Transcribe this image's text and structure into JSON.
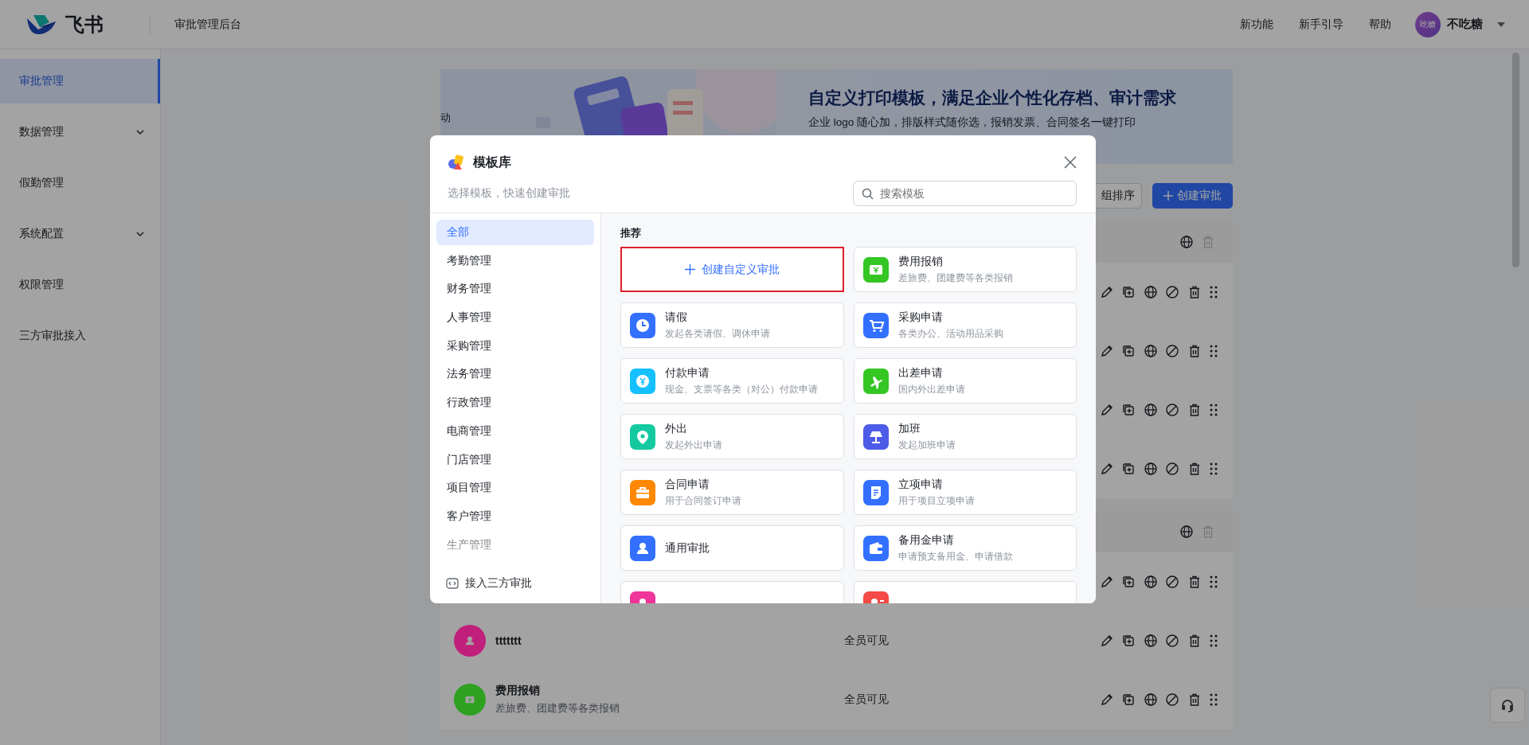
{
  "topbar": {
    "brand": "飞书",
    "title": "审批管理后台",
    "links": [
      "新功能",
      "新手引导",
      "帮助"
    ],
    "user": {
      "avatar_text": "吃糖",
      "name": "不吃糖"
    }
  },
  "sidebar": {
    "items": [
      {
        "label": "审批管理",
        "selected": true,
        "has_submenu": false
      },
      {
        "label": "数据管理",
        "selected": false,
        "has_submenu": true
      },
      {
        "label": "假勤管理",
        "selected": false,
        "has_submenu": false
      },
      {
        "label": "系统配置",
        "selected": false,
        "has_submenu": true
      },
      {
        "label": "权限管理",
        "selected": false,
        "has_submenu": false
      },
      {
        "label": "三方审批接入",
        "selected": false,
        "has_submenu": false
      }
    ]
  },
  "banner": {
    "left_text": "动",
    "title": "自定义打印模板，满足企业个性化存档、审计需求",
    "subtitle": "企业 logo 随心加，排版样式随你选，报销发票、合同签名一键打印"
  },
  "toolbar": {
    "buttons": [
      {
        "label": "组排序",
        "kind": "secondary"
      },
      {
        "label": "创建审批",
        "kind": "primary"
      }
    ]
  },
  "groups": [
    {
      "delete_disabled": true,
      "rows": [
        {
          "kind": "covered"
        },
        {
          "kind": "covered"
        },
        {
          "kind": "covered"
        },
        {
          "kind": "covered"
        }
      ]
    },
    {
      "delete_disabled": true,
      "rows": [
        {
          "kind": "covered"
        },
        {
          "kind": "item",
          "name": "ttttttt",
          "visibility": "全员可见",
          "color": "#c0207c"
        },
        {
          "kind": "item",
          "name": "费用报销",
          "description": "差旅费、团建费等各类报销",
          "visibility": "全员可见",
          "color": "#2ea121"
        }
      ]
    }
  ],
  "modal": {
    "title": "模板库",
    "subtitle": "选择模板，快速创建审批",
    "search": {
      "placeholder": "搜索模板"
    },
    "categories": [
      {
        "label": "全部",
        "selected": true
      },
      {
        "label": "考勤管理",
        "selected": false
      },
      {
        "label": "财务管理",
        "selected": false
      },
      {
        "label": "人事管理",
        "selected": false
      },
      {
        "label": "采购管理",
        "selected": false
      },
      {
        "label": "法务管理",
        "selected": false
      },
      {
        "label": "行政管理",
        "selected": false
      },
      {
        "label": "电商管理",
        "selected": false
      },
      {
        "label": "门店管理",
        "selected": false
      },
      {
        "label": "项目管理",
        "selected": false
      },
      {
        "label": "客户管理",
        "selected": false
      },
      {
        "label": "生产管理",
        "selected": false
      }
    ],
    "footer_link": "接入三方审批",
    "section_title": "推荐",
    "cards": [
      {
        "kind": "create",
        "title": "创建自定义审批"
      },
      {
        "kind": "template",
        "title": "费用报销",
        "description": "差旅费、团建费等各类报销",
        "color": "#34c724"
      },
      {
        "kind": "template",
        "title": "请假",
        "description": "发起各类请假、调休申请",
        "color": "#3370ff"
      },
      {
        "kind": "template",
        "title": "采购申请",
        "description": "各类办公、活动用品采购",
        "color": "#3370ff"
      },
      {
        "kind": "template",
        "title": "付款申请",
        "description": "现金、支票等各类（对公）付款申请",
        "color": "#14c0ff"
      },
      {
        "kind": "template",
        "title": "出差申请",
        "description": "国内外出差申请",
        "color": "#34c724"
      },
      {
        "kind": "template",
        "title": "外出",
        "description": "发起外出申请",
        "color": "#14c9a0"
      },
      {
        "kind": "template",
        "title": "加班",
        "description": "发起加班申请",
        "color": "#4e5be6"
      },
      {
        "kind": "template",
        "title": "合同申请",
        "description": "用于合同签订申请",
        "color": "#ff8800"
      },
      {
        "kind": "template",
        "title": "立项申请",
        "description": "用于项目立项申请",
        "color": "#3370ff"
      },
      {
        "kind": "template",
        "title": "通用审批",
        "color": "#3370ff"
      },
      {
        "kind": "template",
        "title": "备用金申请",
        "description": "申请预支备用金、申请借款",
        "color": "#3370ff"
      },
      {
        "kind": "template",
        "color": "#f0359a"
      },
      {
        "kind": "template",
        "color": "#f54a45"
      }
    ]
  }
}
